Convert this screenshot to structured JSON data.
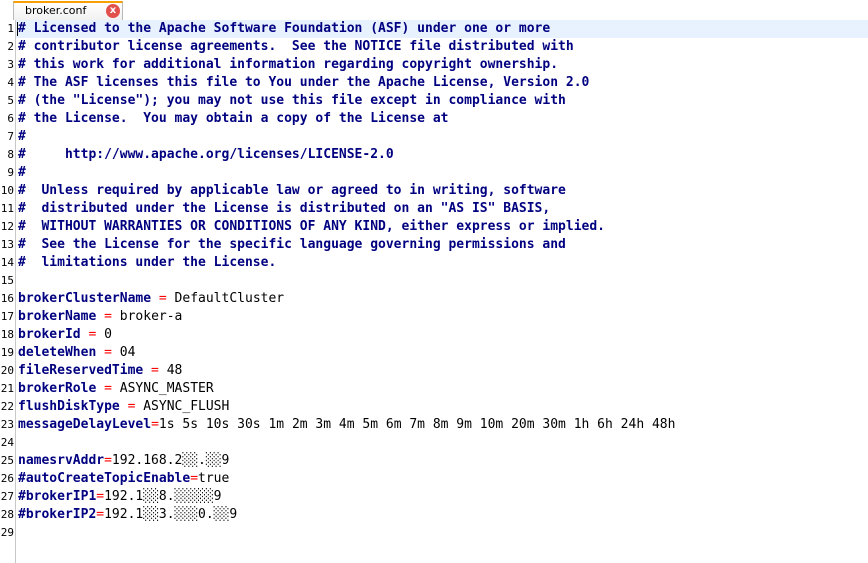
{
  "tab": {
    "title": "broker.conf",
    "close_symbol": "x"
  },
  "lines": [
    {
      "num": "1",
      "kind": "comment",
      "text": "# Licensed to the Apache Software Foundation (ASF) under one or more"
    },
    {
      "num": "2",
      "kind": "comment",
      "text": "# contributor license agreements.  See the NOTICE file distributed with"
    },
    {
      "num": "3",
      "kind": "comment",
      "text": "# this work for additional information regarding copyright ownership."
    },
    {
      "num": "4",
      "kind": "comment",
      "text": "# The ASF licenses this file to You under the Apache License, Version 2.0"
    },
    {
      "num": "5",
      "kind": "comment",
      "text": "# (the \"License\"); you may not use this file except in compliance with"
    },
    {
      "num": "6",
      "kind": "comment",
      "text": "# the License.  You may obtain a copy of the License at"
    },
    {
      "num": "7",
      "kind": "comment",
      "text": "#"
    },
    {
      "num": "8",
      "kind": "comment",
      "text": "#     http://www.apache.org/licenses/LICENSE-2.0"
    },
    {
      "num": "9",
      "kind": "comment",
      "text": "#"
    },
    {
      "num": "10",
      "kind": "comment",
      "text": "#  Unless required by applicable law or agreed to in writing, software"
    },
    {
      "num": "11",
      "kind": "comment",
      "text": "#  distributed under the License is distributed on an \"AS IS\" BASIS,"
    },
    {
      "num": "12",
      "kind": "comment",
      "text": "#  WITHOUT WARRANTIES OR CONDITIONS OF ANY KIND, either express or implied."
    },
    {
      "num": "13",
      "kind": "comment",
      "text": "#  See the License for the specific language governing permissions and"
    },
    {
      "num": "14",
      "kind": "comment",
      "text": "#  limitations under the License."
    },
    {
      "num": "15",
      "kind": "blank",
      "text": ""
    },
    {
      "num": "16",
      "kind": "kv",
      "key": "brokerClusterName",
      "eq": " = ",
      "value": "DefaultCluster"
    },
    {
      "num": "17",
      "kind": "kv",
      "key": "brokerName",
      "eq": " = ",
      "value": "broker-a"
    },
    {
      "num": "18",
      "kind": "kv",
      "key": "brokerId",
      "eq": " = ",
      "value": "0"
    },
    {
      "num": "19",
      "kind": "kv",
      "key": "deleteWhen",
      "eq": " = ",
      "value": "04"
    },
    {
      "num": "20",
      "kind": "kv",
      "key": "fileReservedTime",
      "eq": " = ",
      "value": "48"
    },
    {
      "num": "21",
      "kind": "kv",
      "key": "brokerRole",
      "eq": " = ",
      "value": "ASYNC_MASTER"
    },
    {
      "num": "22",
      "kind": "kv",
      "key": "flushDiskType",
      "eq": " = ",
      "value": "ASYNC_FLUSH"
    },
    {
      "num": "23",
      "kind": "kv",
      "key": "messageDelayLevel",
      "eq": "=",
      "value": "1s 5s 10s 30s 1m 2m 3m 4m 5m 6m 7m 8m 9m 10m 20m 30m 1h 6h 24h 48h"
    },
    {
      "num": "24",
      "kind": "blank",
      "text": ""
    },
    {
      "num": "25",
      "kind": "kv",
      "key": "namesrvAddr",
      "eq": "=",
      "value": "192.168.2░░.░░9"
    },
    {
      "num": "26",
      "kind": "kv",
      "key": "#autoCreateTopicEnable",
      "eq": "=",
      "value": "true"
    },
    {
      "num": "27",
      "kind": "kv",
      "key": "#brokerIP1",
      "eq": "=",
      "value": "192.1░░8.░░░░░9"
    },
    {
      "num": "28",
      "kind": "kv",
      "key": "#brokerIP2",
      "eq": "=",
      "value": "192.1░░3.░░░0.░░9"
    },
    {
      "num": "29",
      "kind": "blank",
      "text": ""
    }
  ],
  "colors": {
    "comment": "#000080",
    "key": "#000080",
    "operator": "#ff0000",
    "value": "#000000",
    "current_line": "#e8f2fe",
    "tab_accent": "#f7a000",
    "close_button": "#e2504c"
  }
}
